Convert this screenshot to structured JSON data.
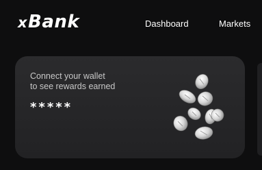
{
  "brand": {
    "prefix": "x",
    "name": "Bank"
  },
  "nav": {
    "items": [
      "Dashboard",
      "Markets"
    ]
  },
  "rewards_card": {
    "message_line1": "Connect your wallet",
    "message_line2": "to see rewards earned",
    "masked_value": "*****"
  },
  "colors": {
    "background": "#0e0e0f",
    "card": "#2a2a2c",
    "coin": "#d9d9d9"
  },
  "icons": {
    "coins": "coins-stack-icon"
  }
}
